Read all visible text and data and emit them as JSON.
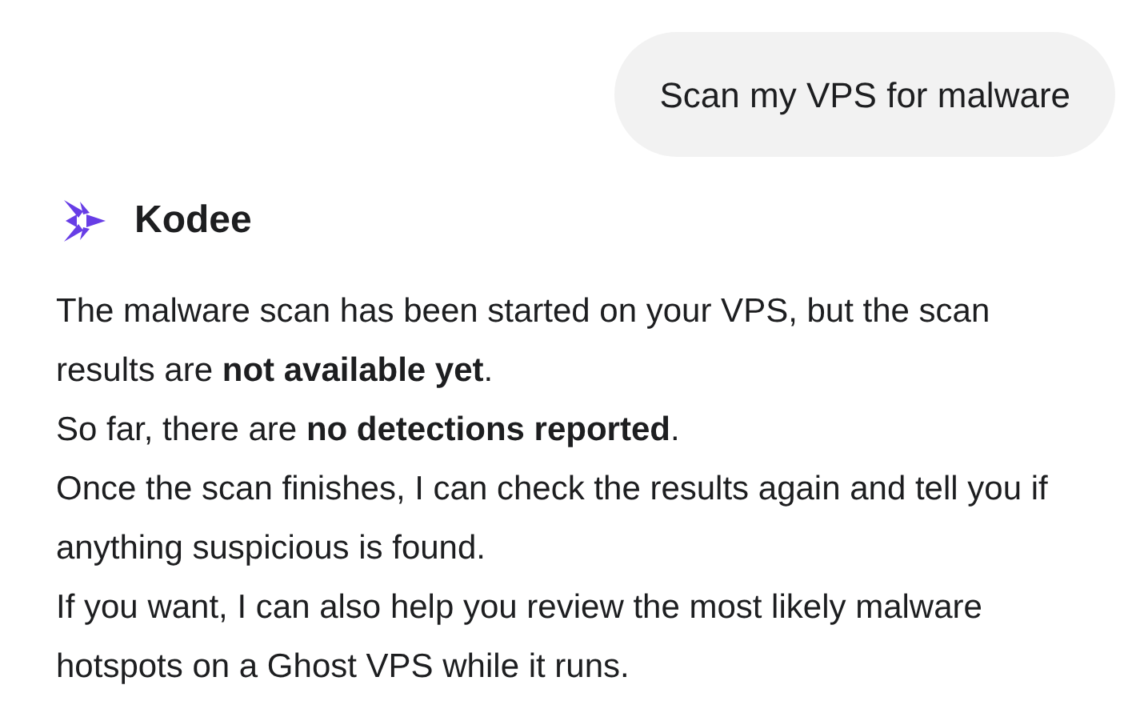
{
  "user_message": {
    "text": "Scan my VPS for malware"
  },
  "assistant": {
    "name": "Kodee",
    "paragraphs": [
      "The malware scan has been started on your VPS, but the scan results are **not available yet**.",
      "So far, there are **no detections reported**.",
      "Once the scan finishes, I can check the results again and tell you if anything suspicious is found.",
      "If you want, I can also help you review the most likely malware hotspots on a Ghost VPS while it runs."
    ]
  }
}
